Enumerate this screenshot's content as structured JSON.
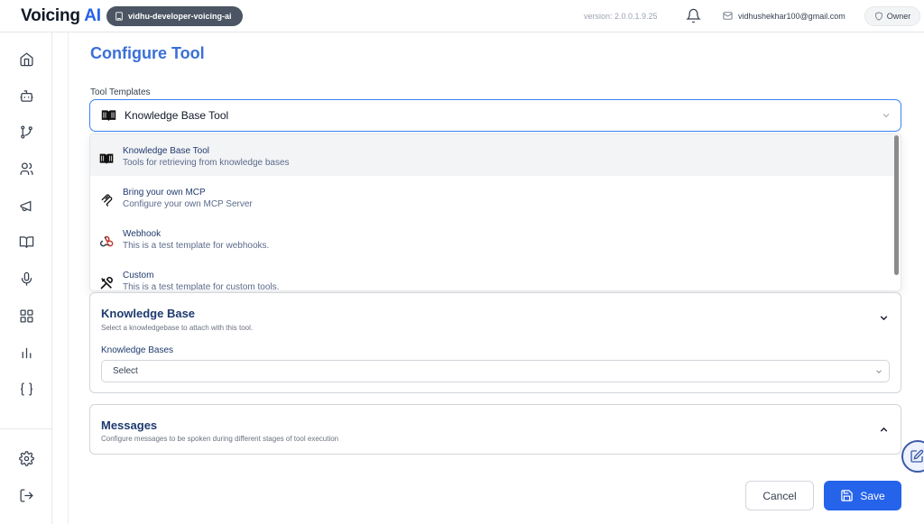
{
  "header": {
    "logo_main": "Voicing",
    "logo_accent": "AI",
    "org_name": "vidhu-developer-voicing-ai",
    "version": "version: 2.0.0.1.9.25",
    "user_email": "vidhushekhar100@gmail.com",
    "role": "Owner"
  },
  "sidebar": {
    "items": [
      {
        "icon": "home-icon"
      },
      {
        "icon": "bot-icon"
      },
      {
        "icon": "git-branch-icon"
      },
      {
        "icon": "users-icon"
      },
      {
        "icon": "megaphone-icon"
      },
      {
        "icon": "book-open-icon"
      },
      {
        "icon": "microphone-icon"
      },
      {
        "icon": "grid-icon"
      },
      {
        "icon": "bar-chart-icon"
      },
      {
        "icon": "braces-icon"
      }
    ],
    "bottom": [
      {
        "icon": "settings-icon"
      },
      {
        "icon": "logout-icon"
      }
    ]
  },
  "main": {
    "title": "Configure Tool",
    "template_label": "Tool Templates",
    "template_value": "Knowledge Base Tool",
    "options": [
      {
        "title": "Knowledge Base Tool",
        "desc": "Tools for retrieving from knowledge bases",
        "icon": "book-icon"
      },
      {
        "title": "Bring your own MCP",
        "desc": "Configure your own MCP Server",
        "icon": "mcp-icon"
      },
      {
        "title": "Webhook",
        "desc": "This is a test template for webhooks.",
        "icon": "webhook-icon"
      },
      {
        "title": "Custom",
        "desc": "This is a test template for custom tools.",
        "icon": "tools-icon"
      }
    ],
    "kb_section": {
      "title": "Knowledge Base",
      "subtitle": "Select a knowledgebase to attach with this tool.",
      "field_label": "Knowledge Bases",
      "select_value": "Select"
    },
    "messages_section": {
      "title": "Messages",
      "subtitle": "Configure messages to be spoken during different stages of tool execution"
    },
    "cancel_label": "Cancel",
    "save_label": "Save"
  },
  "colors": {
    "accent": "#2563eb",
    "title": "#3b6fd8",
    "org_pill": "#4b5563"
  }
}
